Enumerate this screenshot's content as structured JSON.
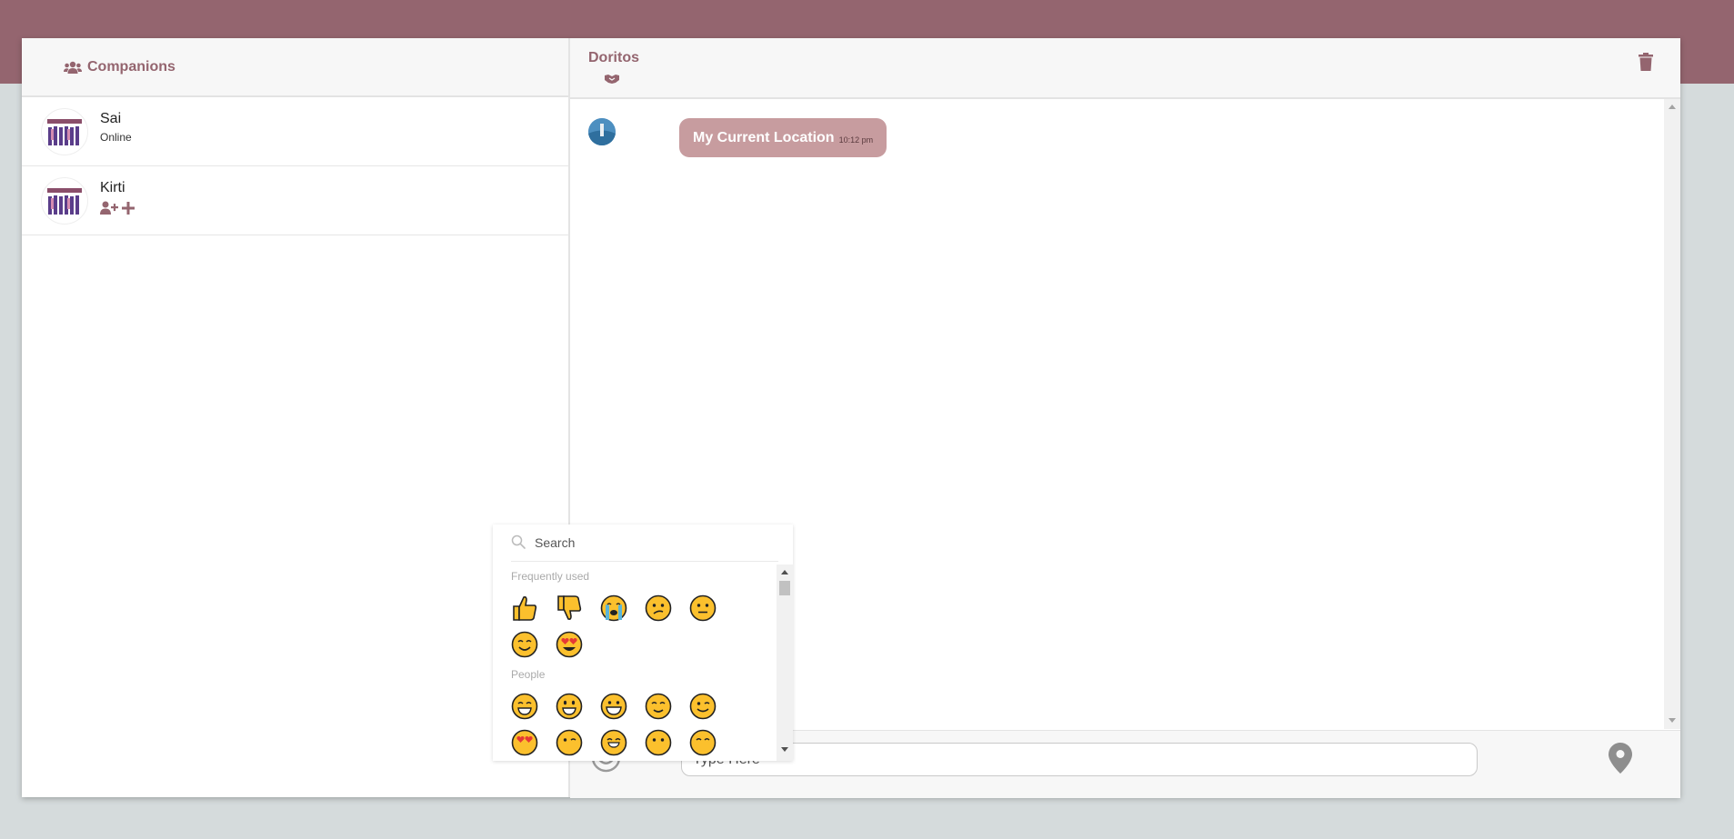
{
  "colors": {
    "brand": "#94656f",
    "bubble": "#c79c9f",
    "background": "#d5dbdc"
  },
  "sidebar": {
    "title": "Companions",
    "title_icon": "users-icon",
    "contacts": [
      {
        "name": "Sai",
        "status": "Online",
        "avatar": "group-photo"
      },
      {
        "name": "Kirti",
        "status": "",
        "avatar": "group-photo",
        "actions": [
          "user-plus-icon",
          "plus-icon"
        ]
      }
    ]
  },
  "chat": {
    "name": "Doritos",
    "header_icon": "handshake-icon",
    "delete_icon": "trash-icon",
    "messages": [
      {
        "text": "My Current Location",
        "time": "10:12 pm"
      }
    ],
    "input": {
      "placeholder": "Type Here",
      "value": ""
    },
    "emoji_icon": "smile-icon",
    "location_icon": "map-marker-icon"
  },
  "emoji_picker": {
    "search_placeholder": "Search",
    "categories": [
      {
        "label": "Frequently used",
        "emojis": [
          "thumbs-up",
          "thumbs-down",
          "loudly-crying-face",
          "confused-face",
          "neutral-face",
          "smiling-face",
          "heart-eyes-face"
        ]
      },
      {
        "label": "People",
        "emojis": [
          "grinning-face",
          "smiley-face",
          "grinning-face-big-eyes",
          "blushing-face",
          "winking-face",
          "heart-eyes-face",
          "kissing-face",
          "hugging-face",
          "hushed-face",
          "smiling-face"
        ]
      }
    ]
  }
}
